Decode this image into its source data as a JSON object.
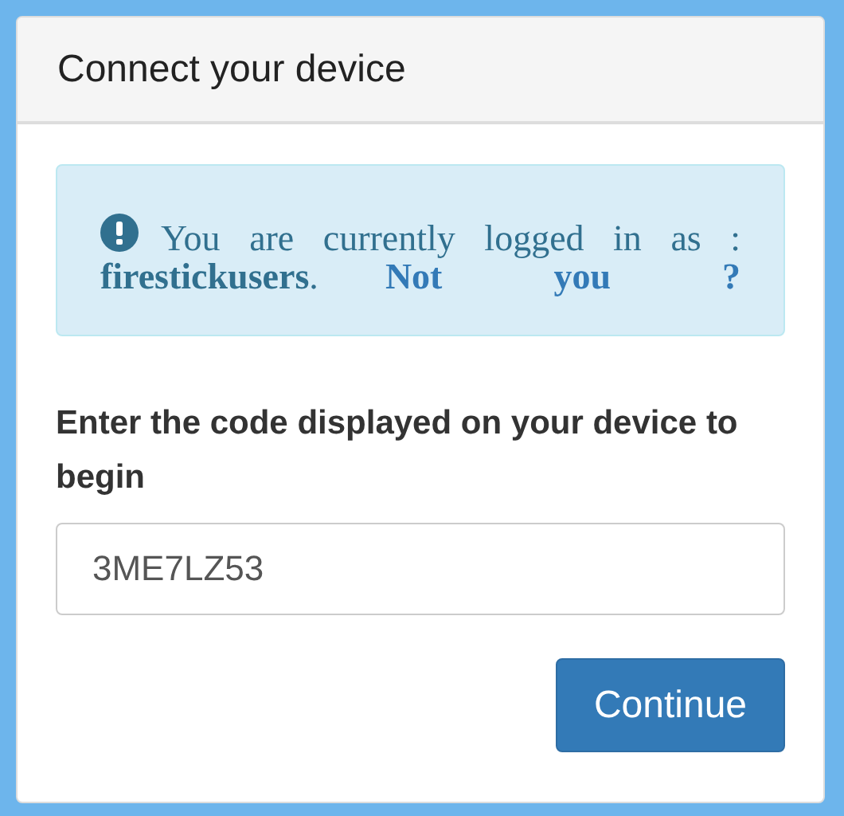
{
  "panel": {
    "title": "Connect your device"
  },
  "alert": {
    "text": "You are currently logged in as : **firestickusers**.",
    "link": "Not you ?"
  },
  "form": {
    "label": "Enter the code displayed on your device to begin",
    "code": "3ME7LZ53"
  },
  "buttons": [
    {
      "label": "Continue"
    }
  ]
}
